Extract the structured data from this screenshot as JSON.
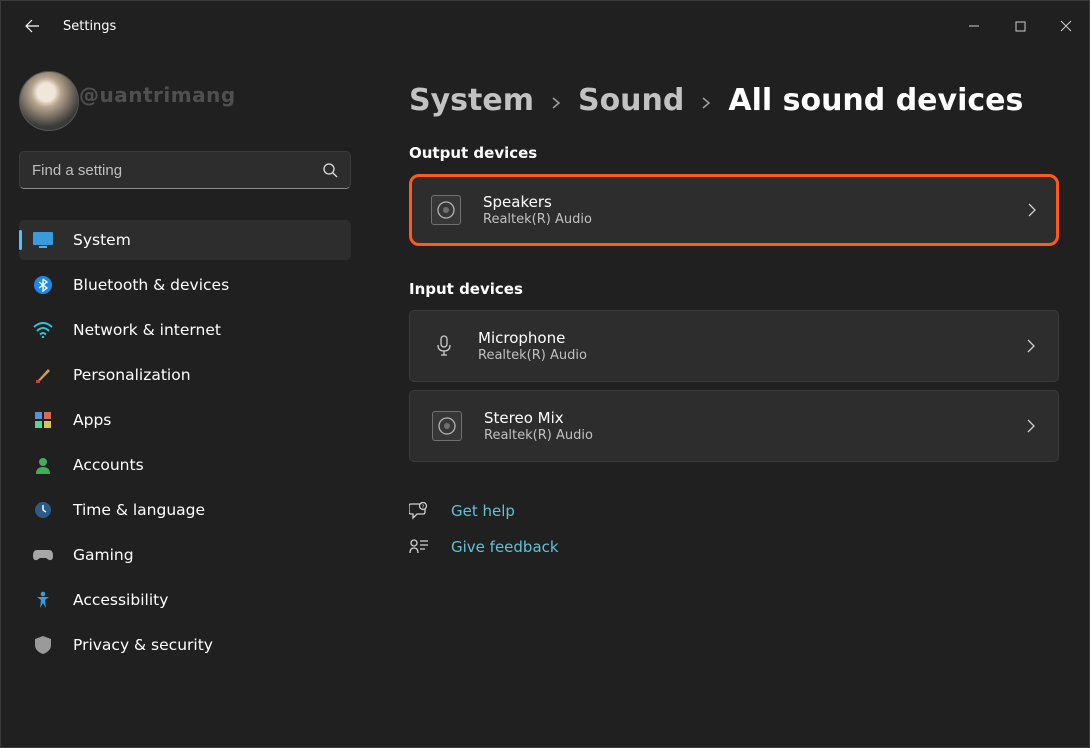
{
  "titlebar": {
    "app_name": "Settings"
  },
  "profile": {
    "watermark": "@uantrimang"
  },
  "search": {
    "placeholder": "Find a setting"
  },
  "nav": {
    "items": [
      {
        "id": "system",
        "label": "System"
      },
      {
        "id": "bluetooth-devices",
        "label": "Bluetooth & devices"
      },
      {
        "id": "network-internet",
        "label": "Network & internet"
      },
      {
        "id": "personalization",
        "label": "Personalization"
      },
      {
        "id": "apps",
        "label": "Apps"
      },
      {
        "id": "accounts",
        "label": "Accounts"
      },
      {
        "id": "time-language",
        "label": "Time & language"
      },
      {
        "id": "gaming",
        "label": "Gaming"
      },
      {
        "id": "accessibility",
        "label": "Accessibility"
      },
      {
        "id": "privacy-security",
        "label": "Privacy & security"
      }
    ],
    "selected_index": 0
  },
  "breadcrumb": {
    "items": [
      "System",
      "Sound",
      "All sound devices"
    ]
  },
  "sections": {
    "output_label": "Output devices",
    "input_label": "Input devices",
    "output": [
      {
        "id": "speakers",
        "title": "Speakers",
        "subtitle": "Realtek(R) Audio",
        "highlighted": true
      }
    ],
    "input": [
      {
        "id": "microphone",
        "title": "Microphone",
        "subtitle": "Realtek(R) Audio"
      },
      {
        "id": "stereo-mix",
        "title": "Stereo Mix",
        "subtitle": "Realtek(R) Audio"
      }
    ]
  },
  "links": {
    "help": "Get help",
    "feedback": "Give feedback"
  },
  "colors": {
    "accent": "#4cc2ff",
    "link": "#5fc2d3",
    "highlight_border": "#ff5a1a"
  }
}
